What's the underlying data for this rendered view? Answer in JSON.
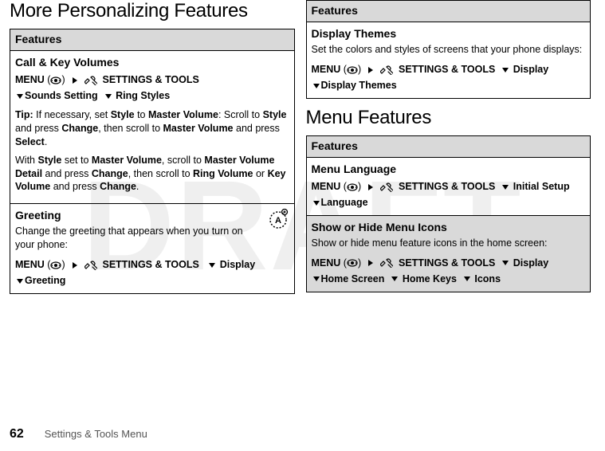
{
  "watermark": "DRAFT",
  "left": {
    "heading": "More Personalizing Features",
    "table": {
      "header": "Features",
      "row1": {
        "title": "Call & Key Volumes",
        "path_menu": "MENU",
        "path_settings": "SETTINGS & TOOLS",
        "path_sounds": "Sounds Setting",
        "path_ring": "Ring Styles",
        "tip_label": "Tip:",
        "tip_pre": " If necessary, set ",
        "tip_style": "Style",
        "tip_to": " to ",
        "tip_mv": "Master Volume",
        "tip_post1": ": Scroll to ",
        "tip_style2": "Style",
        "tip_post2": " and press ",
        "tip_change": "Change",
        "tip_post3": ", then scroll to ",
        "tip_mv2": "Master Volume",
        "tip_post4": " and press ",
        "tip_select": "Select",
        "tip_dot": ".",
        "p2_pre": "With ",
        "p2_style": "Style",
        "p2_set": " set to ",
        "p2_mv": "Master Volume",
        "p2_post1": ", scroll to ",
        "p2_mvd": "Master Volume Detail",
        "p2_post2": " and press ",
        "p2_change": "Change",
        "p2_post3": ", then scroll to ",
        "p2_rv": "Ring Volume",
        "p2_or": " or ",
        "p2_kv": "Key Volume",
        "p2_post4": " and press ",
        "p2_change2": "Change",
        "p2_dot": "."
      },
      "row2": {
        "title": "Greeting",
        "desc": "Change the greeting that appears when you turn on your phone:",
        "path_menu": "MENU",
        "path_settings": "SETTINGS & TOOLS",
        "path_display": "Display",
        "path_greeting": "Greeting"
      }
    }
  },
  "right": {
    "table1": {
      "header": "Features",
      "row1": {
        "title": "Display Themes",
        "desc": "Set the colors and styles of screens that your phone displays:",
        "path_menu": "MENU",
        "path_settings": "SETTINGS & TOOLS",
        "path_display": "Display",
        "path_themes": "Display Themes"
      }
    },
    "heading2": "Menu Features",
    "table2": {
      "header": "Features",
      "row1": {
        "title": "Menu Language",
        "path_menu": "MENU",
        "path_settings": "SETTINGS & TOOLS",
        "path_initial": "Initial Setup",
        "path_lang": "Language"
      },
      "row2": {
        "title": "Show or Hide Menu Icons",
        "desc": "Show or hide menu feature icons in the home screen:",
        "path_menu": "MENU",
        "path_settings": "SETTINGS & TOOLS",
        "path_display": "Display",
        "path_home": "Home Screen",
        "path_keys": "Home Keys",
        "path_icons": "Icons"
      }
    }
  },
  "footer": {
    "page": "62",
    "text": "Settings & Tools Menu"
  }
}
